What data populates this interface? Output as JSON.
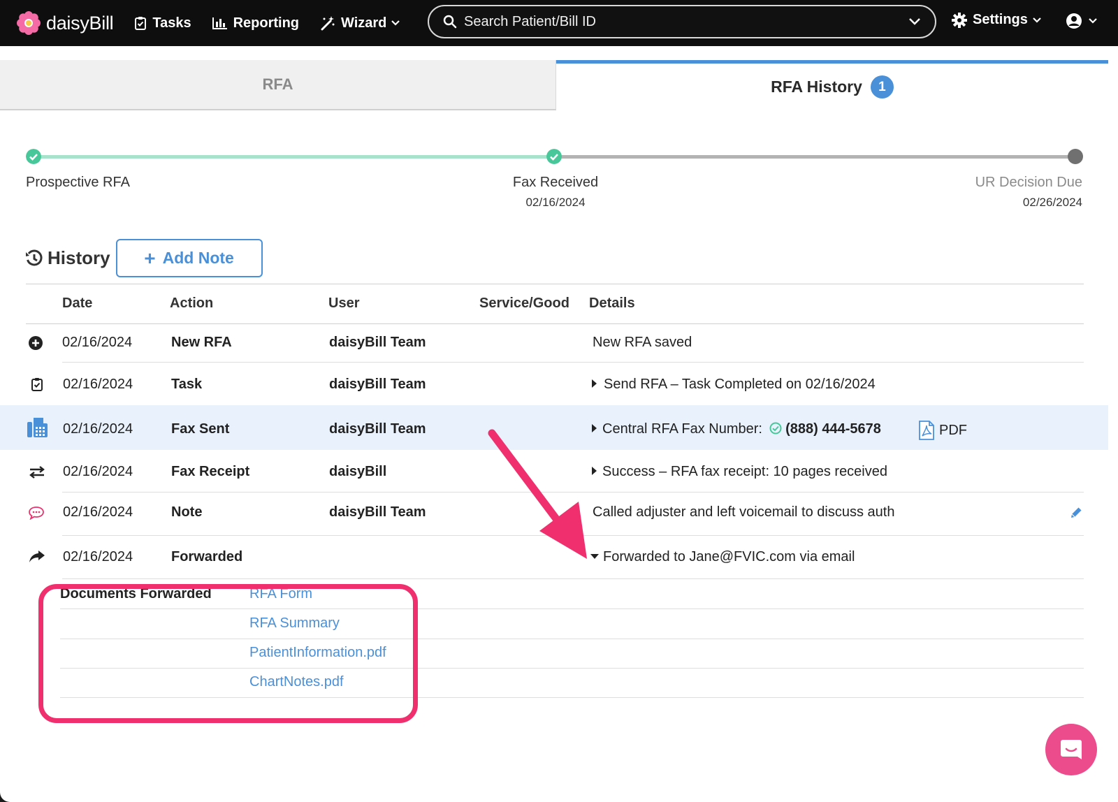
{
  "nav": {
    "brand": "daisyBill",
    "tasks": "Tasks",
    "reporting": "Reporting",
    "wizard": "Wizard",
    "search_placeholder": "Search Patient/Bill ID",
    "settings": "Settings"
  },
  "tabs": {
    "rfa": "RFA",
    "history": "RFA History",
    "history_badge": "1"
  },
  "progress": {
    "steps": [
      {
        "label": "Prospective RFA",
        "date": "",
        "status": "complete"
      },
      {
        "label": "Fax Received",
        "date": "02/16/2024",
        "status": "complete"
      },
      {
        "label": "UR Decision Due",
        "date": "02/26/2024",
        "status": "pending"
      }
    ]
  },
  "history": {
    "title": "History",
    "add_note": "Add Note",
    "columns": [
      "Date",
      "Action",
      "User",
      "Service/Good",
      "Details"
    ],
    "rows": [
      {
        "icon": "plus-circle-icon",
        "date": "02/16/2024",
        "action": "New RFA",
        "user": "daisyBill Team",
        "service": "",
        "details": "New RFA saved"
      },
      {
        "icon": "task-clipboard-icon",
        "date": "02/16/2024",
        "action": "Task",
        "user": "daisyBill Team",
        "service": "",
        "details": "Send RFA – Task Completed on 02/16/2024"
      },
      {
        "icon": "fax-machine-icon",
        "date": "02/16/2024",
        "action": "Fax Sent",
        "user": "daisyBill Team",
        "service": "",
        "details_label": "Central RFA Fax Number:",
        "details_value": "(888) 444-5678",
        "attachment": "PDF"
      },
      {
        "icon": "exchange-arrows-icon",
        "date": "02/16/2024",
        "action": "Fax Receipt",
        "user": "daisyBill",
        "service": "",
        "details": "Success – RFA fax receipt: 10 pages received"
      },
      {
        "icon": "speech-bubble-icon",
        "date": "02/16/2024",
        "action": "Note",
        "user": "daisyBill Team",
        "service": "",
        "details": "Called adjuster and left voicemail to discuss auth"
      },
      {
        "icon": "forward-arrow-icon",
        "date": "02/16/2024",
        "action": "Forwarded",
        "user": "",
        "service": "",
        "details": "Forwarded to Jane@FVIC.com via email"
      }
    ],
    "documents_forwarded_label": "Documents Forwarded",
    "documents": [
      "RFA Form",
      "RFA Summary",
      "PatientInformation.pdf",
      "ChartNotes.pdf"
    ]
  },
  "colors": {
    "accent": "#4a90d9",
    "success": "#48c89a",
    "highlight": "#f0306e",
    "row_highlight": "#e8f1fc"
  }
}
